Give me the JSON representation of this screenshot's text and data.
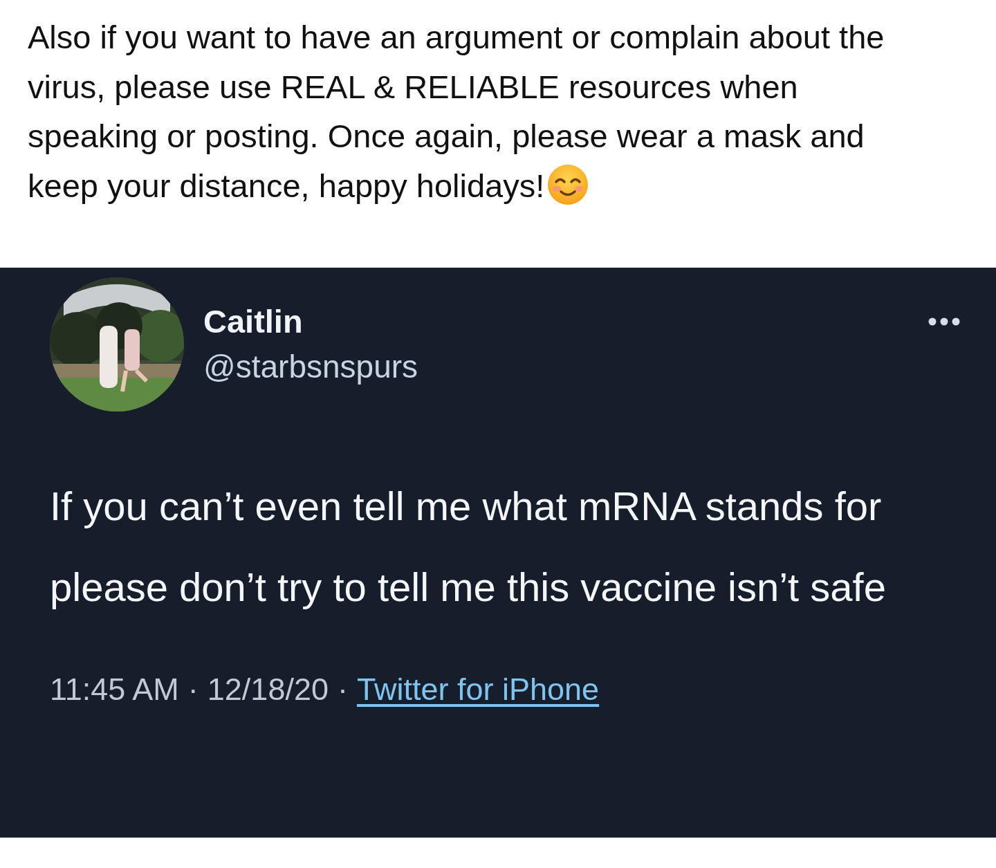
{
  "post": {
    "text": "Also if you want to have an argument or complain about the virus, please use REAL & RELIABLE resources when speaking or posting. Once again, please wear a mask and keep your distance, happy holidays!"
  },
  "tweet": {
    "author_name": "Caitlin",
    "handle": "@starbsnspurs",
    "text": "If you can’t even tell me what mRNA stands for please don’t try to tell me this vaccine isn’t safe",
    "footer": [
      {
        "kind": "text",
        "text": "11:45 AM"
      },
      {
        "kind": "separator",
        "text": "·"
      },
      {
        "kind": "text",
        "text": "12/18/20"
      },
      {
        "kind": "separator",
        "text": "·"
      },
      {
        "kind": "link",
        "text": "Twitter for iPhone"
      }
    ]
  }
}
